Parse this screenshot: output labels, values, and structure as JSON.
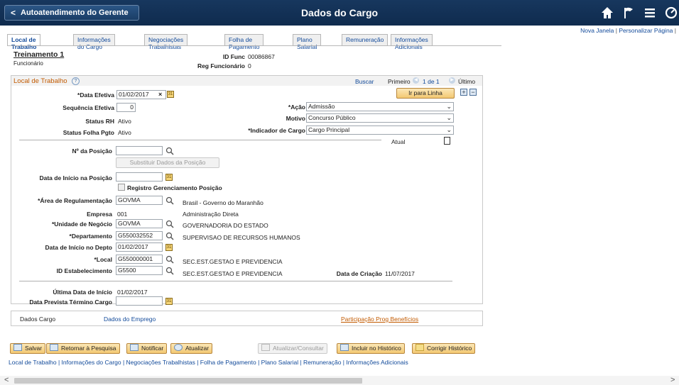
{
  "header": {
    "back_label": "Autoatendimento do Gerente",
    "title": "Dados do Cargo"
  },
  "tablinks": {
    "new_window": "Nova Janela",
    "personalize": "Personalizar Página",
    "sep": "|"
  },
  "tabs": [
    {
      "label": "Local de Trabalho",
      "active": true
    },
    {
      "label": "Informações do Cargo"
    },
    {
      "label": "Negociações Trabalhistas"
    },
    {
      "label": "Folha de Pagamento"
    },
    {
      "label": "Plano Salarial"
    },
    {
      "label": "Remuneração"
    },
    {
      "label": "Informações Adicionais"
    }
  ],
  "employee": {
    "name": "Treinamento 1",
    "role": "Funcionário",
    "id_func_label": "ID Func",
    "id_func": "00086867",
    "reg_label": "Reg Funcionário",
    "reg": "0"
  },
  "section": {
    "title": "Local de Trabalho",
    "help": "?",
    "search": "Buscar",
    "first": "Primeiro",
    "counter": "1 de 1",
    "last": "Último",
    "goto_line": "Ir para Linha",
    "add": "+",
    "remove": "−"
  },
  "fields": {
    "data_efetiva_label": "*Data Efetiva",
    "data_efetiva": "01/02/2017",
    "seq_label": "Sequência Efetiva",
    "seq": "0",
    "status_rh_label": "Status RH",
    "status_rh": "Ativo",
    "status_folha_label": "Status Folha Pgto",
    "status_folha": "Ativo",
    "acao_label": "*Ação",
    "acao": "Admissão",
    "motivo_label": "Motivo",
    "motivo": "Concurso Público",
    "indicador_label": "*Indicador de Cargo",
    "indicador": "Cargo Principal",
    "atual_label": "Atual",
    "posicao_label": "Nº da Posição",
    "posicao": "",
    "substituir_label": "Substituir Dados da Posição",
    "inicio_posicao_label": "Data de Início na Posição",
    "inicio_posicao": "",
    "registro_label": "Registro Gerenciamento Posição",
    "area_label": "*Área de Regulamentação",
    "area": "GOVMA",
    "area_desc": "Brasil - Governo do Maranhão",
    "empresa_label": "Empresa",
    "empresa": "001",
    "empresa_desc": "Administração Direta",
    "unidade_label": "*Unidade de Negócio",
    "unidade": "GOVMA",
    "unidade_desc": "GOVERNADORIA DO ESTADO",
    "depto_label": "*Departamento",
    "depto": "G550032552",
    "depto_desc": "SUPERVISAO DE RECURSOS HUMANOS",
    "inicio_depto_label": "Data de Início no Depto",
    "inicio_depto": "01/02/2017",
    "local_label": "*Local",
    "local": "G550000001",
    "local_desc": "SEC.EST.GESTAO E PREVIDENCIA",
    "estab_label": "ID Estabelecimento",
    "estab": "G5500",
    "estab_desc": "SEC.EST.GESTAO E PREVIDENCIA",
    "criacao_label": "Data de Criação",
    "criacao": "11/07/2017",
    "ultima_label": "Última Data de Início",
    "ultima": "01/02/2017",
    "termino_label": "Data Prevista Término Cargo",
    "termino": ""
  },
  "footer_links": {
    "dados_cargo": "Dados Cargo",
    "dados_emprego": "Dados do Emprego",
    "beneficios": "Participação Prog Benefícios"
  },
  "buttons": {
    "salvar": "Salvar",
    "retornar": "Retornar à Pesquisa",
    "notificar": "Notificar",
    "atualizar": "Atualizar",
    "atualizar_consultar": "Atualizar/Consultar",
    "incluir": "Incluir no Histórico",
    "corrigir": "Corrigir Histórico"
  },
  "bottom_links": "Local de Trabalho | Informações do Cargo | Negociações Trabalhistas | Folha de Pagamento | Plano Salarial | Remuneração | Informações Adicionais"
}
